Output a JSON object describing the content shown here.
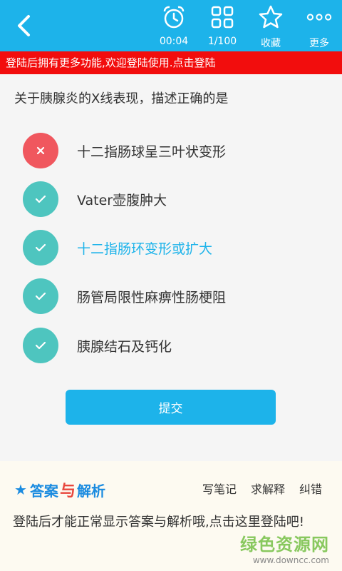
{
  "toolbar": {
    "timer_label": "00:04",
    "progress_label": "1/100",
    "favorite_label": "收藏",
    "more_label": "更多"
  },
  "banner": {
    "text": "登陆后拥有更多功能,欢迎登陆使用.点击登陆"
  },
  "question": {
    "text": "关于胰腺炎的X线表现，描述正确的是"
  },
  "options": [
    {
      "text": "十二指肠球呈三叶状变形",
      "state": "wrong"
    },
    {
      "text": "Vater壶腹肿大",
      "state": "correct"
    },
    {
      "text": "十二指肠环变形或扩大",
      "state": "correct-highlight"
    },
    {
      "text": "肠管局限性麻痹性肠梗阻",
      "state": "correct"
    },
    {
      "text": "胰腺结石及钙化",
      "state": "correct"
    }
  ],
  "submit": {
    "label": "提交"
  },
  "answer": {
    "title_part1": "答案",
    "title_part2": "与",
    "title_part3": "解析",
    "actions": [
      "写笔记",
      "求解释",
      "纠错"
    ],
    "message": "登陆后才能正常显示答案与解析哦,点击这里登陆吧!"
  },
  "watermark": {
    "brand": "绿色资源网",
    "url": "www.downcc.com"
  },
  "colors": {
    "primary": "#1db3ea",
    "banner_red": "#f20d0d",
    "wrong_red": "#f0575e",
    "correct_teal": "#4ec5bf",
    "highlight_blue": "#1db3ea",
    "answer_blue": "#1a8be0"
  }
}
